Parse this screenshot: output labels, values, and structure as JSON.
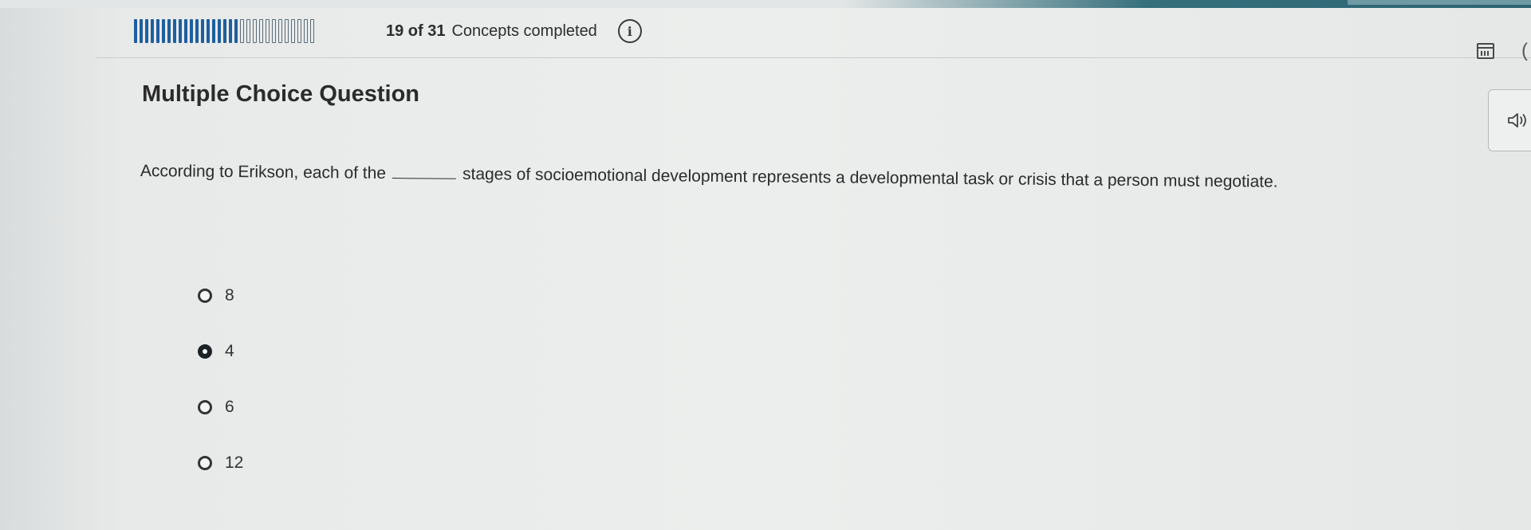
{
  "progress": {
    "completed": 19,
    "total": 31,
    "count_label": "19 of 31",
    "suffix_label": "Concepts completed"
  },
  "icons": {
    "info": "info-icon",
    "calendar": "calendar-icon",
    "audio": "speaker-icon"
  },
  "question": {
    "type_label": "Multiple Choice Question",
    "text_before": "According to Erikson, each of the",
    "text_after": "stages of socioemotional development represents a developmental task or crisis that a person must negotiate.",
    "options": [
      {
        "label": "8",
        "selected": false
      },
      {
        "label": "4",
        "selected": true
      },
      {
        "label": "6",
        "selected": false
      },
      {
        "label": "12",
        "selected": false
      }
    ]
  },
  "colors": {
    "progress_filled": "#1f5f9e",
    "header_accent": "#2c6472"
  }
}
